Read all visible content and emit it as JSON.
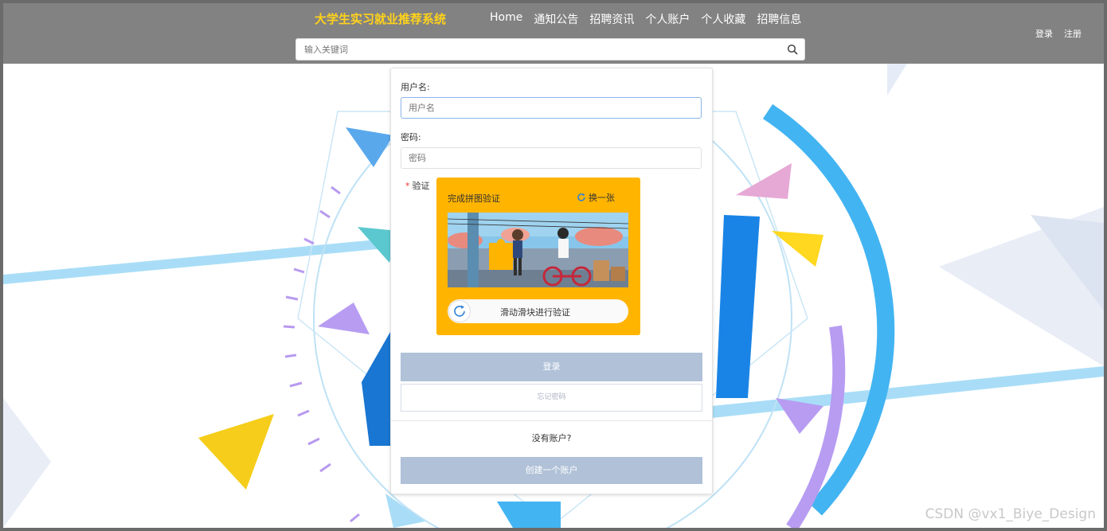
{
  "header": {
    "brand": "大学生实习就业推荐系统",
    "nav": [
      "Home",
      "通知公告",
      "招聘资讯",
      "个人账户",
      "个人收藏",
      "招聘信息"
    ],
    "login_label": "登录",
    "register_label": "注册"
  },
  "search": {
    "placeholder": "输入关键词",
    "icon": "search-icon"
  },
  "form": {
    "username_label": "用户名:",
    "username_placeholder": "用户名",
    "password_label": "密码:",
    "password_placeholder": "密码",
    "captcha_label": "验证",
    "captcha_title": "完成拼图验证",
    "captcha_refresh": "换一张",
    "slider_text": "滑动滑块进行验证",
    "login_button": "登录",
    "forgot_button": "忘记密码",
    "no_account": "没有账户?",
    "create_account_button": "创建一个账户"
  },
  "watermark": "CSDN @vx1_Biye_Design",
  "colors": {
    "topbar": "#828282",
    "brand": "#ffd21a",
    "captcha_bg": "#ffb400",
    "primary_button": "#b0c1d8"
  }
}
